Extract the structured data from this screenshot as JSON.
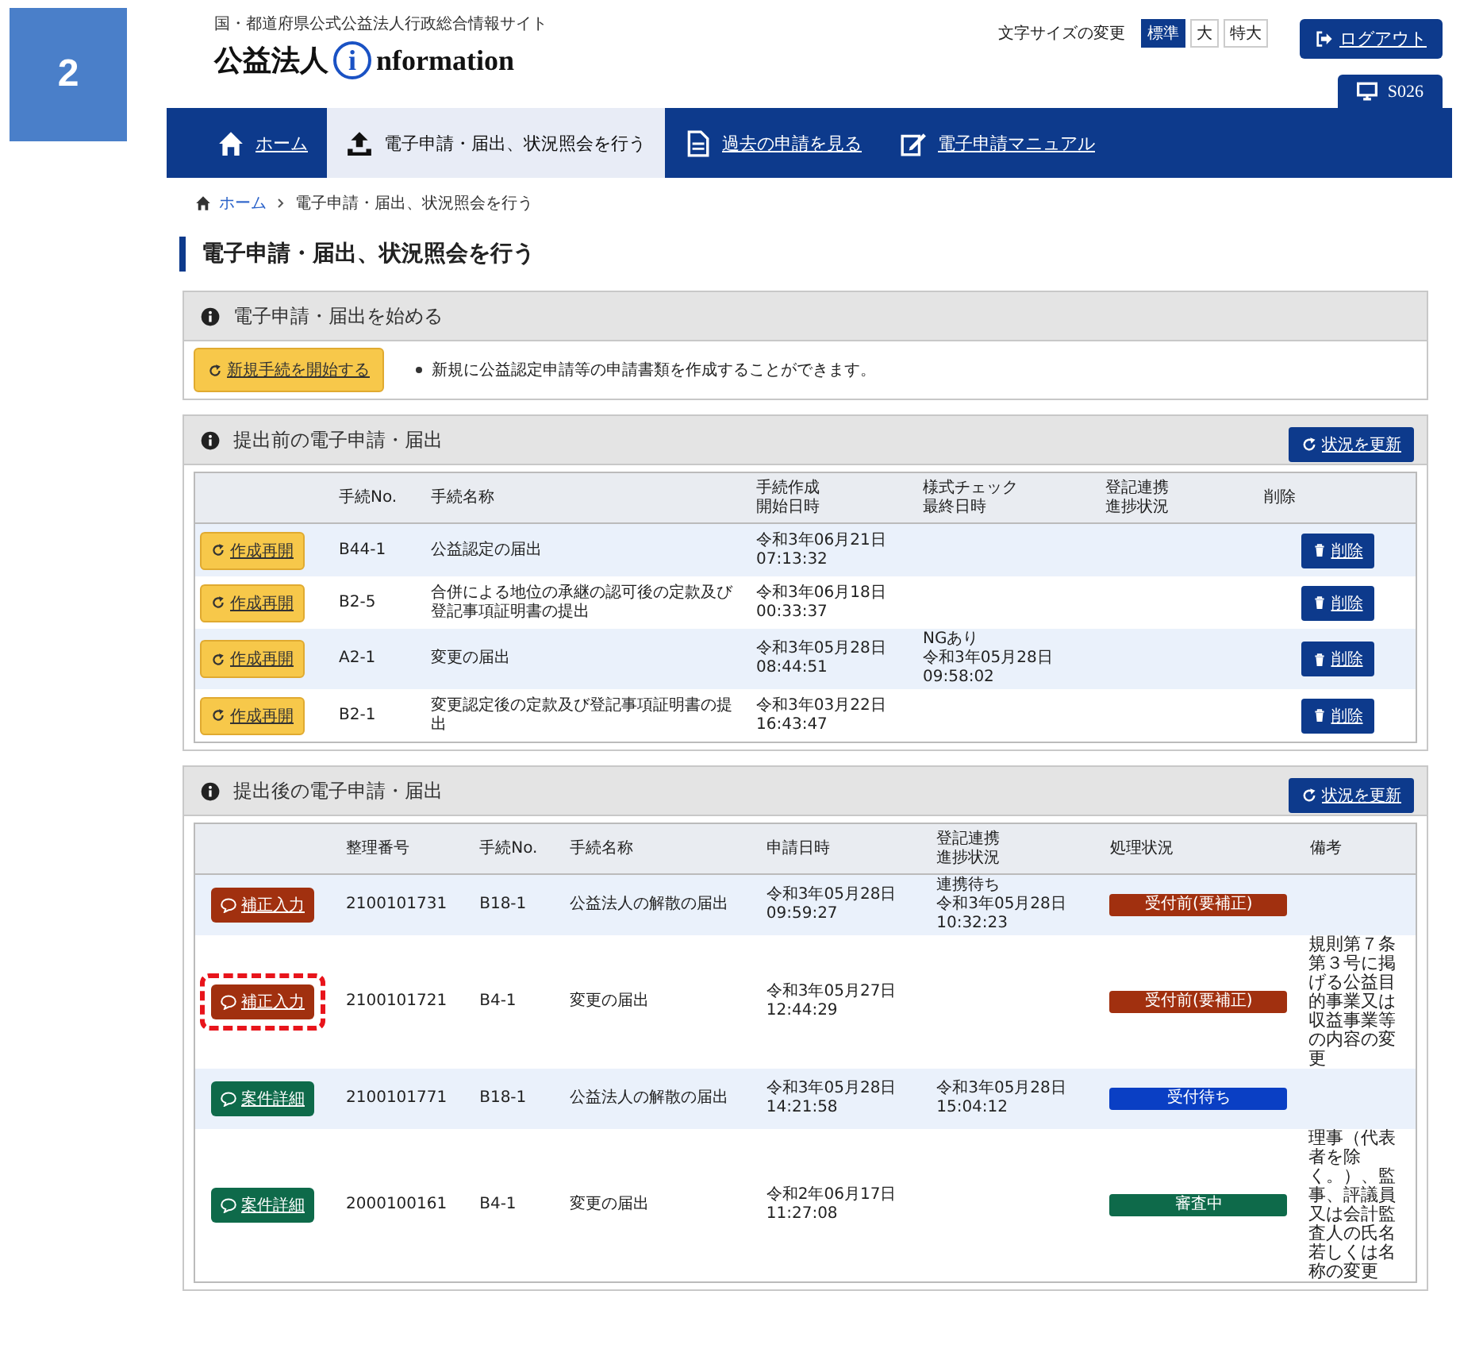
{
  "step_badge": "2",
  "header": {
    "site_caption": "国・都道府県公式公益法人行政総合情報サイト",
    "logo_text": "公益法人",
    "logo_mark": "i",
    "logo_suffix": "nformation",
    "font_size_label": "文字サイズの変更",
    "font_sizes": [
      {
        "label": "標準",
        "selected": true
      },
      {
        "label": "大",
        "selected": false
      },
      {
        "label": "特大",
        "selected": false
      }
    ],
    "logout": "ログアウト",
    "user_code": "S026"
  },
  "nav": [
    {
      "kind": "home",
      "label": "ホーム",
      "selected": false
    },
    {
      "kind": "upload",
      "label": "電子申請・届出、状況照会を行う",
      "selected": true
    },
    {
      "kind": "document",
      "label": "過去の申請を見る",
      "selected": false
    },
    {
      "kind": "edit",
      "label": "電子申請マニュアル",
      "selected": false
    }
  ],
  "breadcrumb": {
    "home": "ホーム",
    "current": "電子申請・届出、状況照会を行う"
  },
  "page_title": "電子申請・届出、状況照会を行う",
  "start_panel": {
    "title": "電子申請・届出を始める",
    "button": "新規手続を開始する",
    "note": "新規に公益認定申請等の申請書類を作成することができます。"
  },
  "draft_panel": {
    "title": "提出前の電子申請・届出",
    "refresh": "状況を更新",
    "columns": [
      [
        "手続No."
      ],
      [
        "手続名称"
      ],
      [
        "手続作成",
        "開始日時"
      ],
      [
        "様式チェック",
        "最終日時"
      ],
      [
        "登記連携",
        "進捗状況"
      ],
      [
        "削除"
      ]
    ],
    "rows": [
      {
        "resume": "作成再開",
        "no": "B44-1",
        "name": "公益認定の届出",
        "started": [
          "令和3年06月21日",
          "07:13:32"
        ],
        "delete": "削除"
      },
      {
        "resume": "作成再開",
        "no": "B2-5",
        "name": "合併による地位の承継の認可後の定款及び登記事項証明書の提出",
        "started": [
          "令和3年06月18日",
          "00:33:37"
        ],
        "delete": "削除"
      },
      {
        "resume": "作成再開",
        "no": "A2-1",
        "name": "変更の届出",
        "started": [
          "令和3年05月28日",
          "08:44:51"
        ],
        "checked_at": [
          "NGあり",
          "令和3年05月28日",
          "09:58:02"
        ],
        "delete": "削除"
      },
      {
        "resume": "作成再開",
        "no": "B2-1",
        "name": "変更認定後の定款及び登記事項証明書の提出",
        "started": [
          "令和3年03月22日",
          "16:43:47"
        ],
        "delete": "削除"
      }
    ]
  },
  "submitted_panel": {
    "title": "提出後の電子申請・届出",
    "refresh": "状況を更新",
    "columns": [
      [
        "整理番号"
      ],
      [
        "手続No."
      ],
      [
        "手続名称"
      ],
      [
        "申請日時"
      ],
      [
        "登記連携",
        "進捗状況"
      ],
      [
        "処理状況"
      ],
      [
        "備考"
      ]
    ],
    "rows": [
      {
        "action": {
          "kind": "correct",
          "label": "補正入力"
        },
        "highlighted": false,
        "number": "2100101731",
        "no": "B18-1",
        "name": "公益法人の解散の届出",
        "applied": [
          "令和3年05月28日",
          "09:59:27"
        ],
        "registry": [
          "連携待ち",
          "令和3年05月28日",
          "10:32:23"
        ],
        "status": {
          "label": "受付前(要補正)",
          "color": "#a1300f"
        }
      },
      {
        "action": {
          "kind": "correct",
          "label": "補正入力"
        },
        "highlighted": true,
        "number": "2100101721",
        "no": "B4-1",
        "name": "変更の届出",
        "applied": [
          "令和3年05月27日",
          "12:44:29"
        ],
        "status": {
          "label": "受付前(要補正)",
          "color": "#a1300f"
        },
        "remarks": "規則第７条第３号に掲げる公益目的事業又は収益事業等の内容の変更"
      },
      {
        "action": {
          "kind": "detail",
          "label": "案件詳細"
        },
        "highlighted": false,
        "number": "2100101771",
        "no": "B18-1",
        "name": "公益法人の解散の届出",
        "applied": [
          "令和3年05月28日",
          "14:21:58"
        ],
        "registry": [
          "令和3年05月28日",
          "15:04:12"
        ],
        "status": {
          "label": "受付待ち",
          "color": "#0a3fc4"
        }
      },
      {
        "action": {
          "kind": "detail",
          "label": "案件詳細"
        },
        "highlighted": false,
        "number": "2000100161",
        "no": "B4-1",
        "name": "変更の届出",
        "applied": [
          "令和2年06月17日",
          "11:27:08"
        ],
        "status": {
          "label": "審査中",
          "color": "#0e6a4a"
        },
        "remarks": "理事（代表者を除く。）、監事、評議員又は会計監査人の氏名若しくは名称の変更"
      }
    ]
  }
}
